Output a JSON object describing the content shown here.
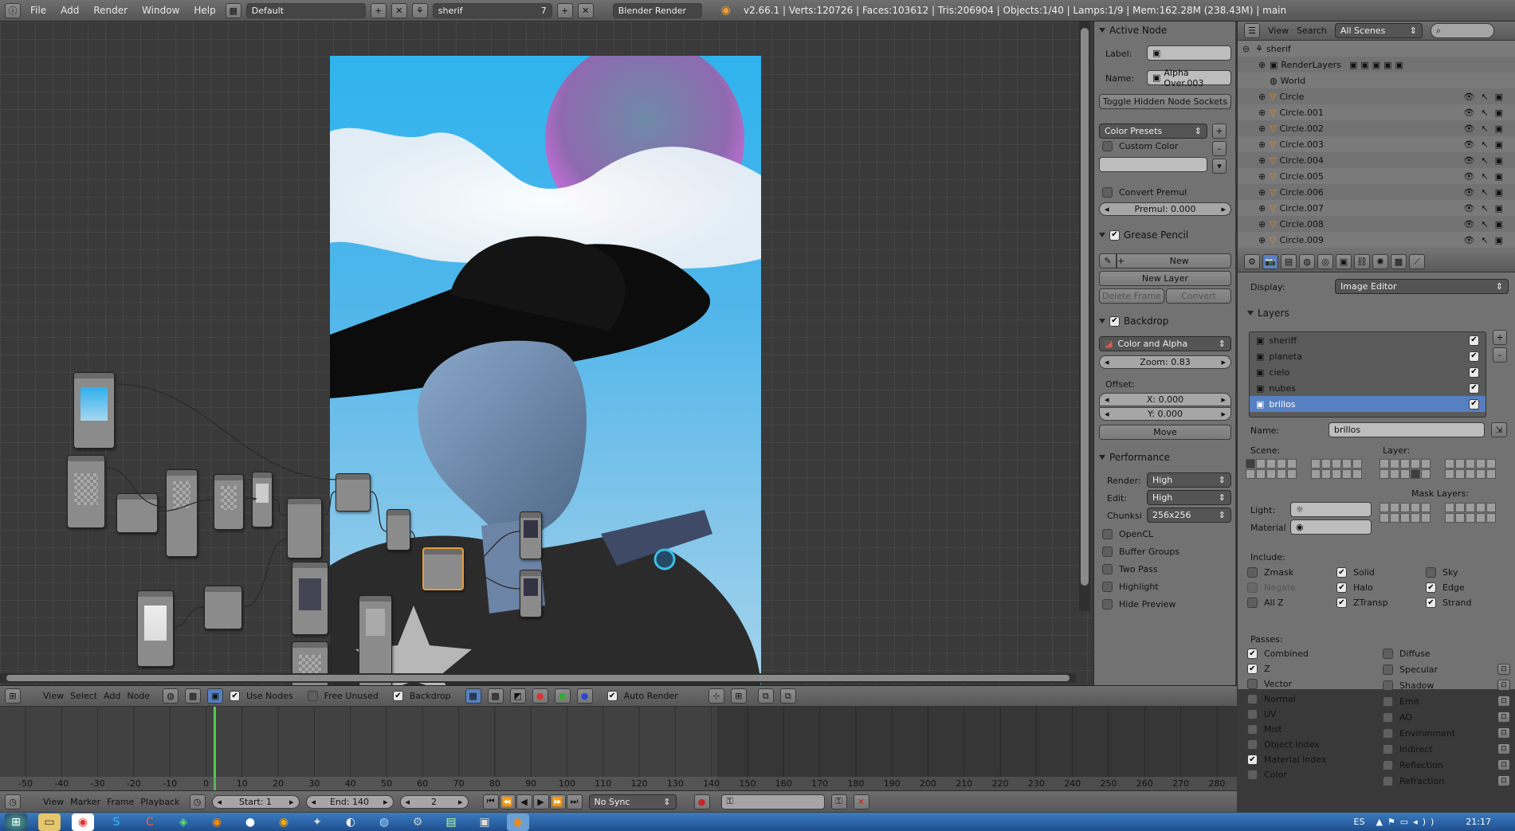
{
  "topbar": {
    "menus": [
      "File",
      "Add",
      "Render",
      "Window",
      "Help"
    ],
    "layout": "Default",
    "scene": "sherif",
    "scene_users": "7",
    "engine": "Blender Render",
    "info": "v2.66.1 | Verts:120726 | Faces:103612 | Tris:206904 | Objects:1/40 | Lamps:1/9 | Mem:162.28M (238.43M) | main"
  },
  "active_node": {
    "title": "Active Node",
    "label_caption": "Label:",
    "label_value": "",
    "name_caption": "Name:",
    "name_value": "Alpha Over.003",
    "toggle_button": "Toggle Hidden Node Sockets",
    "color_presets": "Color Presets",
    "custom_color": "Custom Color",
    "convert_premul": "Convert Premul",
    "premul": "Premul: 0.000"
  },
  "grease_pencil": {
    "title": "Grease Pencil",
    "new": "New",
    "new_layer": "New Layer",
    "delete_frame": "Delete Frame",
    "convert": "Convert"
  },
  "backdrop": {
    "title": "Backdrop",
    "mode": "Color and Alpha",
    "zoom": "Zoom: 0.83",
    "offset_caption": "Offset:",
    "x": "X: 0.000",
    "y": "Y: 0.000",
    "move": "Move"
  },
  "performance": {
    "title": "Performance",
    "render_caption": "Render:",
    "render_value": "High",
    "edit_caption": "Edit:",
    "edit_value": "High",
    "chunks_caption": "Chunksi",
    "chunks_value": "256x256",
    "options": [
      "OpenCL",
      "Buffer Groups",
      "Two Pass",
      "Highlight",
      "Hide Preview"
    ]
  },
  "outliner": {
    "view": "View",
    "search": "Search",
    "scenes": "All Scenes",
    "root": "sherif",
    "items": [
      "RenderLayers",
      "World",
      "Circle",
      "Circle.001",
      "Circle.002",
      "Circle.003",
      "Circle.004",
      "Circle.005",
      "Circle.006",
      "Circle.007",
      "Circle.008",
      "Circle.009"
    ]
  },
  "render_layers": {
    "display_caption": "Display:",
    "display_value": "Image Editor",
    "layers_title": "Layers",
    "layers": [
      {
        "name": "sheriff",
        "checked": true
      },
      {
        "name": "planeta",
        "checked": true
      },
      {
        "name": "cielo",
        "checked": true
      },
      {
        "name": "nubes",
        "checked": true
      },
      {
        "name": "brillos",
        "checked": true
      }
    ],
    "name_caption": "Name:",
    "name_value": "brillos",
    "scene_caption": "Scene:",
    "layer_caption": "Layer:",
    "mask_layers_caption": "Mask Layers:",
    "light_caption": "Light:",
    "material_caption": "Material",
    "include_caption": "Include:",
    "include": [
      {
        "label": "Zmask",
        "checked": false
      },
      {
        "label": "Solid",
        "checked": true
      },
      {
        "label": "Sky",
        "checked": false
      },
      {
        "label": "Negate",
        "checked": false
      },
      {
        "label": "Halo",
        "checked": true
      },
      {
        "label": "Edge",
        "checked": true
      },
      {
        "label": "All Z",
        "checked": false
      },
      {
        "label": "ZTransp",
        "checked": true
      },
      {
        "label": "Strand",
        "checked": true
      }
    ],
    "passes_caption": "Passes:",
    "passes_left": [
      {
        "label": "Combined",
        "checked": true
      },
      {
        "label": "Z",
        "checked": true
      },
      {
        "label": "Vector",
        "checked": false
      },
      {
        "label": "Normal",
        "checked": false
      },
      {
        "label": "UV",
        "checked": false
      },
      {
        "label": "Mist",
        "checked": false
      },
      {
        "label": "Object Index",
        "checked": false
      },
      {
        "label": "Material Index",
        "checked": true
      },
      {
        "label": "Color",
        "checked": false
      }
    ],
    "passes_right": [
      {
        "label": "Diffuse",
        "checked": false
      },
      {
        "label": "Specular",
        "checked": false
      },
      {
        "label": "Shadow",
        "checked": false
      },
      {
        "label": "Emit",
        "checked": false
      },
      {
        "label": "AO",
        "checked": false
      },
      {
        "label": "Environment",
        "checked": false
      },
      {
        "label": "Indirect",
        "checked": false
      },
      {
        "label": "Reflection",
        "checked": false
      },
      {
        "label": "Refraction",
        "checked": false
      }
    ]
  },
  "node_header": {
    "menus": [
      "View",
      "Select",
      "Add",
      "Node"
    ],
    "use_nodes": "Use Nodes",
    "free_unused": "Free Unused",
    "backdrop": "Backdrop",
    "auto_render": "Auto Render"
  },
  "timeline": {
    "ticks": [
      "-50",
      "-40",
      "-30",
      "-20",
      "-10",
      "0",
      "10",
      "20",
      "30",
      "40",
      "50",
      "60",
      "70",
      "80",
      "90",
      "100",
      "110",
      "120",
      "130",
      "140",
      "150",
      "160",
      "170",
      "180",
      "190",
      "200",
      "210",
      "220",
      "230",
      "240",
      "250",
      "260",
      "270",
      "280"
    ],
    "current_frame_marker": 0
  },
  "bottombar": {
    "menus": [
      "View",
      "Marker",
      "Frame",
      "Playback"
    ],
    "start": "Start: 1",
    "end": "End: 140",
    "current": "2",
    "sync": "No Sync"
  },
  "taskbar": {
    "lang": "ES",
    "time": "21:17"
  }
}
